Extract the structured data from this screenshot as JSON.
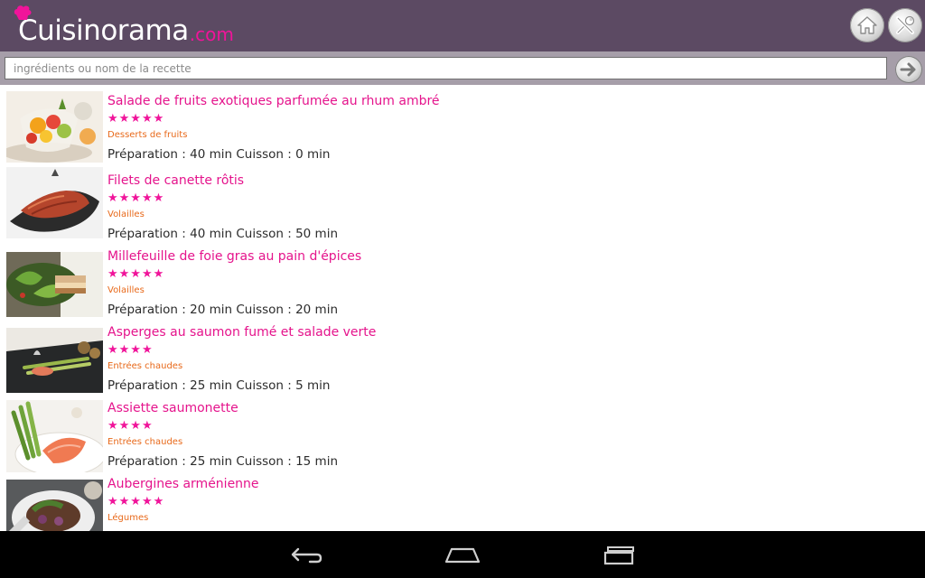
{
  "header": {
    "logo_main": "Cuisinorama",
    "logo_suffix": ".com",
    "home_icon": "home-icon",
    "tools_icon": "tools-icon"
  },
  "search": {
    "placeholder": "ingrédients ou nom de la recette",
    "value": "",
    "go_icon": "arrow-right-icon"
  },
  "colors": {
    "header_bg": "#5c4a63",
    "accent_pink": "#e5148c",
    "category_orange": "#e8691a",
    "searchbar_bg": "#a69ea9"
  },
  "recipes": [
    {
      "title": "Salade de fruits exotiques parfumée au rhum ambré",
      "stars": "★★★★★",
      "rating": 5,
      "category": "Desserts de fruits",
      "time": "Préparation : 40 min Cuisson : 0 min"
    },
    {
      "title": "Filets de canette rôtis",
      "stars": "★★★★★",
      "rating": 5,
      "category": "Volailles",
      "time": "Préparation : 40 min Cuisson : 50 min"
    },
    {
      "title": "Millefeuille de foie gras au pain d'épices",
      "stars": "★★★★★",
      "rating": 5,
      "category": "Volailles",
      "time": "Préparation : 20 min Cuisson : 20 min"
    },
    {
      "title": "Asperges au saumon fumé et salade verte",
      "stars": "★★★★",
      "rating": 4,
      "category": "Entrées chaudes",
      "time": "Préparation : 25 min Cuisson : 5 min"
    },
    {
      "title": "Assiette saumonette",
      "stars": "★★★★",
      "rating": 4,
      "category": "Entrées chaudes",
      "time": "Préparation : 25 min Cuisson : 15 min"
    },
    {
      "title": "Aubergines arménienne",
      "stars": "★★★★★",
      "rating": 5,
      "category": "Légumes",
      "time": ""
    }
  ],
  "navbar": {
    "back_icon": "back-icon",
    "home_icon": "android-home-icon",
    "recents_icon": "recents-icon"
  }
}
